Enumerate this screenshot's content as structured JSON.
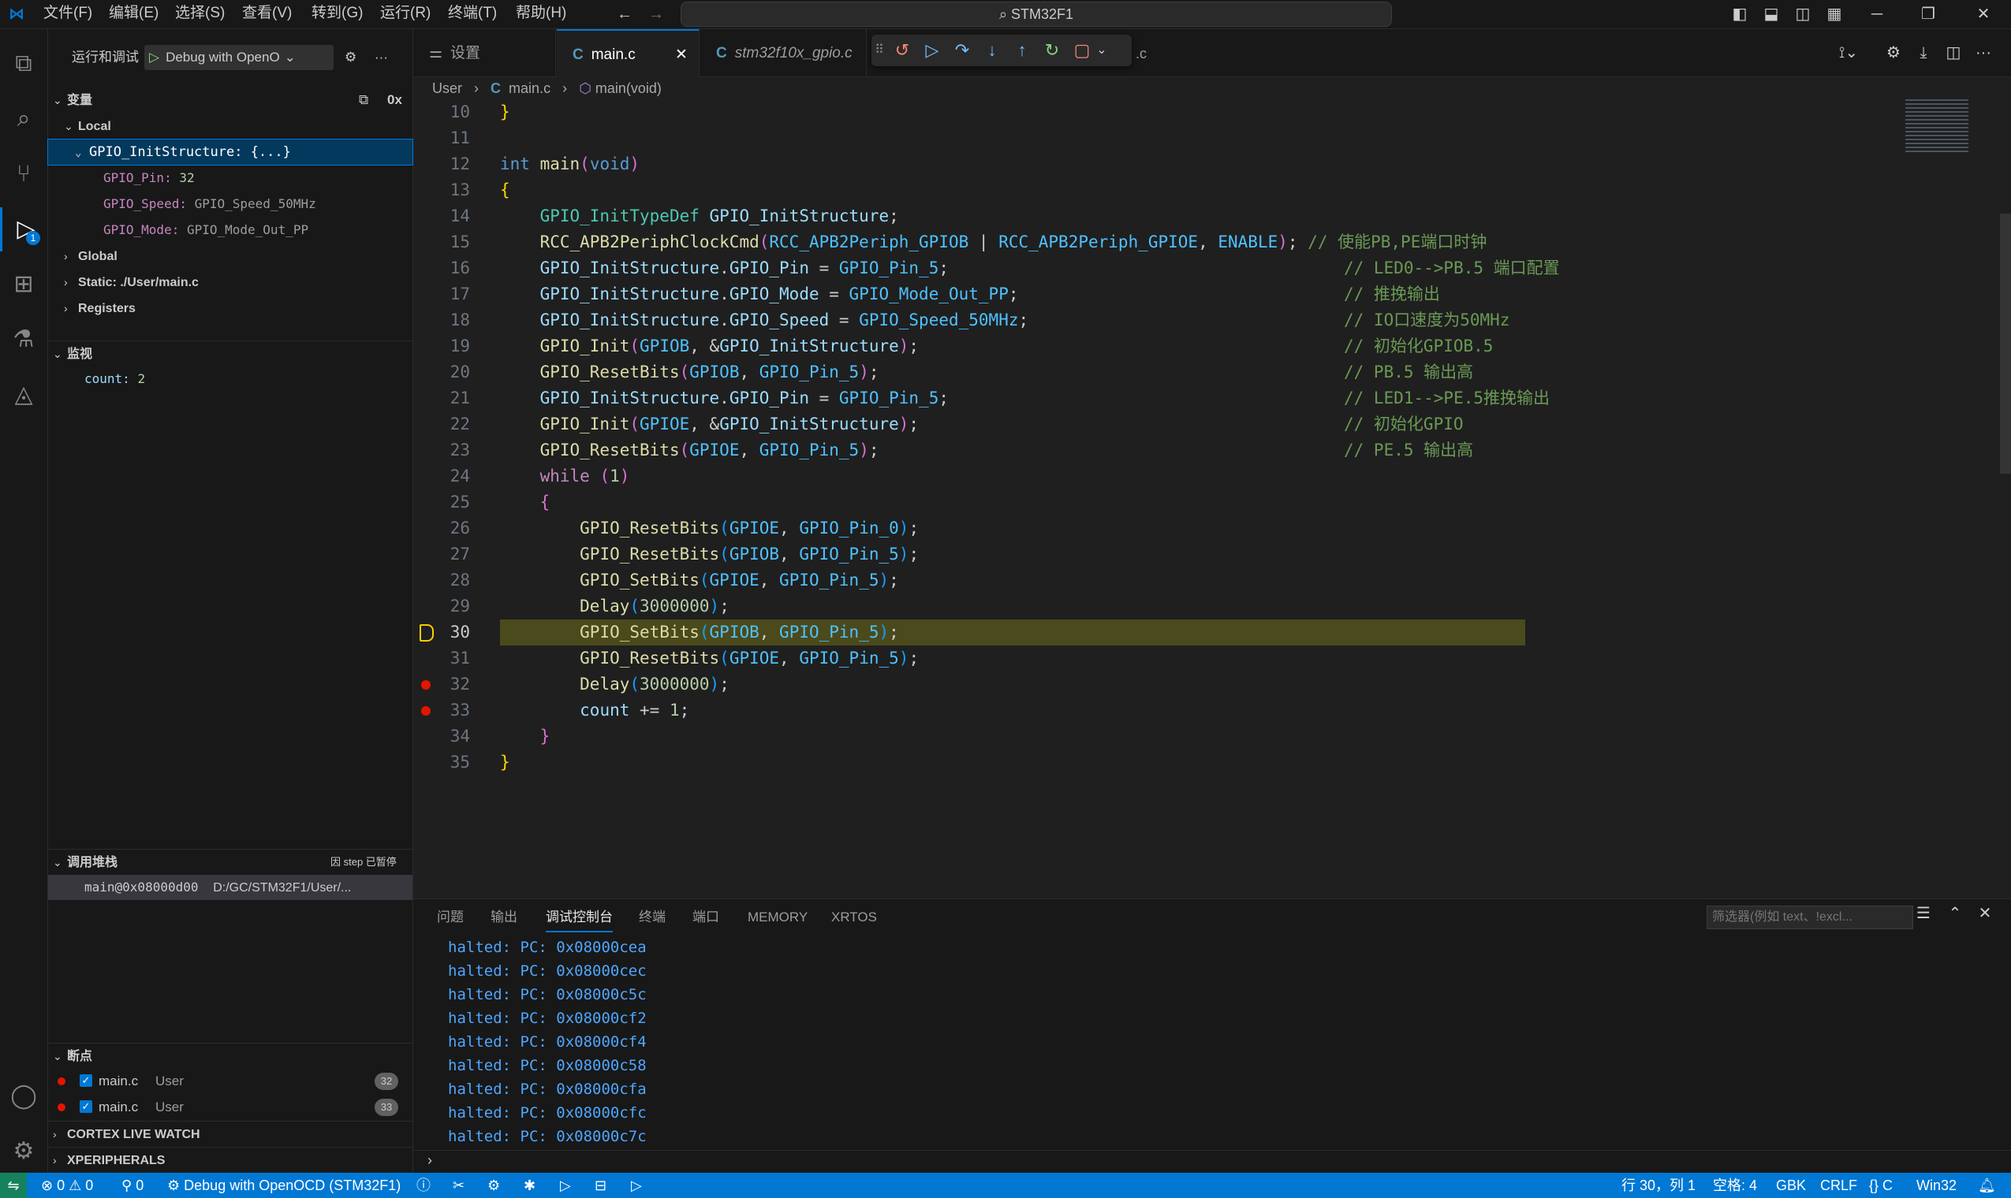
{
  "titlebar": {
    "menus": [
      "文件(F)",
      "编辑(E)",
      "选择(S)",
      "查看(V)",
      "转到(G)",
      "运行(R)",
      "终端(T)",
      "帮助(H)"
    ],
    "search": "STM32F1"
  },
  "sidebar": {
    "header": "运行和调试",
    "config": "Debug with OpenO",
    "variables": {
      "title": "变量",
      "hex_toggle": "0x",
      "local": "Local",
      "struct": "GPIO_InitStructure: {...}",
      "fields": [
        {
          "name": "GPIO_Pin:",
          "value": "32"
        },
        {
          "name": "GPIO_Speed:",
          "value": "GPIO_Speed_50MHz"
        },
        {
          "name": "GPIO_Mode:",
          "value": "GPIO_Mode_Out_PP"
        }
      ],
      "scopes": [
        "Global",
        "Static: ./User/main.c",
        "Registers"
      ]
    },
    "watch": {
      "title": "监视",
      "expr": "count:",
      "value": "2"
    },
    "callstack": {
      "title": "调用堆栈",
      "status": "因 step 已暂停",
      "frame": "main@0x08000d00",
      "path": "D:/GC/STM32F1/User/..."
    },
    "breakpoints": {
      "title": "断点",
      "items": [
        {
          "file": "main.c",
          "dir": "User",
          "line": "32"
        },
        {
          "file": "main.c",
          "dir": "User",
          "line": "33"
        }
      ]
    },
    "extra_sections": [
      "CORTEX LIVE WATCH",
      "XPERIPHERALS"
    ]
  },
  "tabs": [
    {
      "label": "设置"
    },
    {
      "label": "main.c"
    },
    {
      "label": "stm32f10x_gpio.c"
    }
  ],
  "tab_overflow": ".c",
  "breadcrumb": {
    "folder": "User",
    "file": "main.c",
    "symbol": "main(void)"
  },
  "editor": {
    "line_numbers": [
      "10",
      "11",
      "12",
      "13",
      "14",
      "15",
      "16",
      "17",
      "18",
      "19",
      "20",
      "21",
      "22",
      "23",
      "24",
      "25",
      "26",
      "27",
      "28",
      "29",
      "30",
      "31",
      "32",
      "33",
      "34",
      "35"
    ],
    "comments": {
      "c15": "// 使能PB,PE端口时钟",
      "c16": "// LED0-->PB.5 端口配置",
      "c17": "// 推挽输出",
      "c18": "// IO口速度为50MHz",
      "c19": "// 初始化GPIOB.5",
      "c20": "// PB.5 输出高",
      "c21": "// LED1-->PE.5推挽输出",
      "c22": "// 初始化GPIO",
      "c23": "// PE.5 输出高"
    }
  },
  "panel": {
    "tabs": [
      "问题",
      "输出",
      "调试控制台",
      "终端",
      "端口",
      "MEMORY",
      "XRTOS"
    ],
    "filter_placeholder": "筛选器(例如 text、!excl...",
    "output": [
      {
        "h": "halted:",
        "t": "PC: 0x08000cea"
      },
      {
        "h": "halted:",
        "t": "PC: 0x08000cec"
      },
      {
        "h": "halted:",
        "t": "PC: 0x08000c5c"
      },
      {
        "h": "halted:",
        "t": "PC: 0x08000cf2"
      },
      {
        "h": "halted:",
        "t": "PC: 0x08000cf4"
      },
      {
        "h": "halted:",
        "t": "PC: 0x08000c58"
      },
      {
        "h": "halted:",
        "t": "PC: 0x08000cfa"
      },
      {
        "h": "halted:",
        "t": "PC: 0x08000cfc"
      },
      {
        "h": "halted:",
        "t": "PC: 0x08000c7c"
      }
    ]
  },
  "status": {
    "errors": "0",
    "warnings": "0",
    "ports": "0",
    "debug": "Debug with OpenOCD (STM32F1)",
    "position": "行 30，列 1",
    "spaces": "空格: 4",
    "encoding": "GBK",
    "eol": "CRLF",
    "language": "{} C",
    "platform": "Win32"
  }
}
